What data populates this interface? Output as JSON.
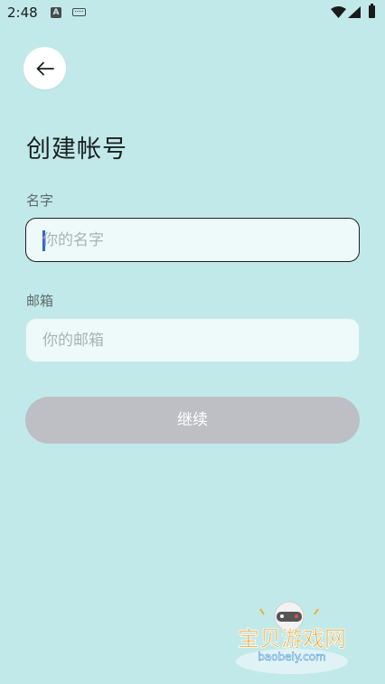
{
  "status_bar": {
    "time": "2:48",
    "icons": [
      "text-a-icon",
      "keyboard-icon",
      "wifi-icon",
      "signal-icon",
      "battery-icon"
    ]
  },
  "back_button": {
    "icon": "arrow-left-icon"
  },
  "page": {
    "title": "创建帐号"
  },
  "form": {
    "name": {
      "label": "名字",
      "value": "",
      "placeholder": "你的名字"
    },
    "email": {
      "label": "邮箱",
      "value": "",
      "placeholder": "你的邮箱"
    },
    "continue_label": "继续"
  },
  "watermark": {
    "text": "宝贝游戏网",
    "url": "baobeiy.com"
  },
  "colors": {
    "background": "#c2e9e9",
    "input_bg": "#eef9f9",
    "button_disabled": "#bdbfc4",
    "caret": "#2d63d8"
  }
}
